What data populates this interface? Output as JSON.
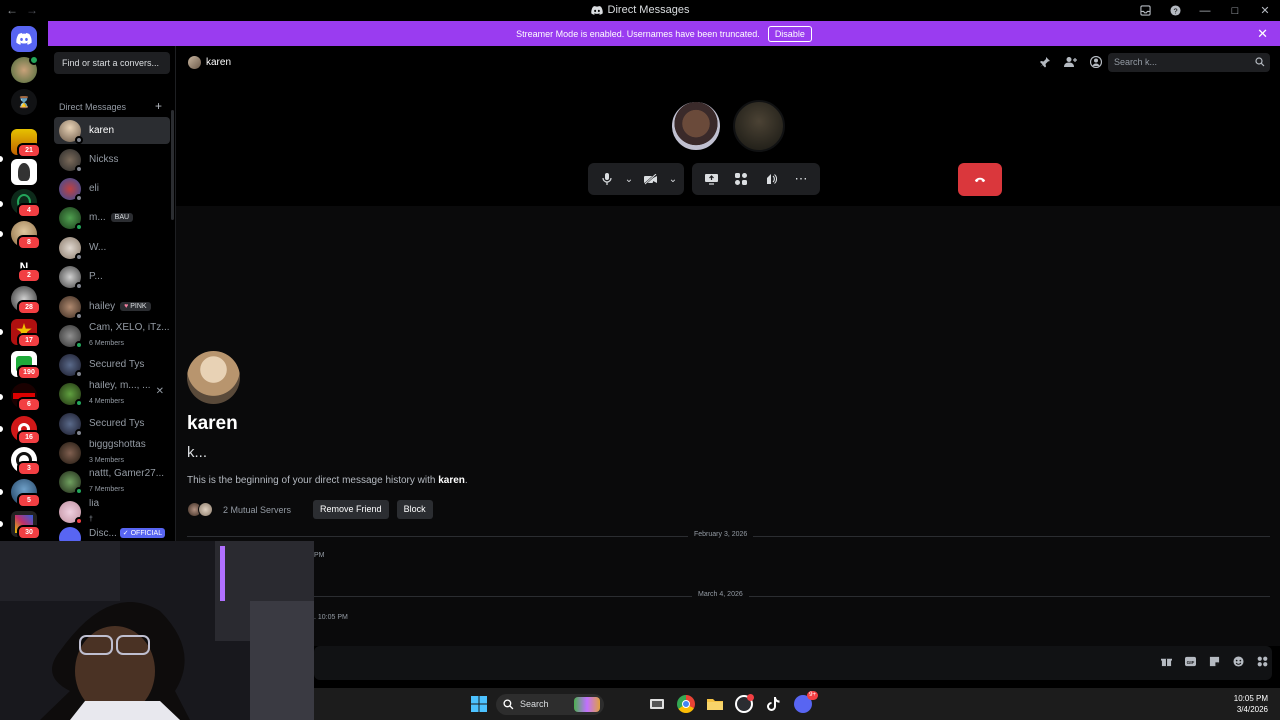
{
  "window": {
    "title": "Direct Messages"
  },
  "banner": {
    "text": "Streamer Mode is enabled. Usernames have been truncated.",
    "button": "Disable"
  },
  "servers": [
    {
      "badge": ""
    },
    {
      "badge": "21"
    },
    {
      "badge": ""
    },
    {
      "badge": "4"
    },
    {
      "badge": "8"
    },
    {
      "badge": "2"
    },
    {
      "badge": "28"
    },
    {
      "badge": "17"
    },
    {
      "badge": "190"
    },
    {
      "badge": "6"
    },
    {
      "badge": "16"
    },
    {
      "badge": "3"
    },
    {
      "badge": "5"
    },
    {
      "badge": "30"
    }
  ],
  "sidebar": {
    "find_placeholder": "Find or start a convers...",
    "section_title": "Direct Messages",
    "add_glyph": "+",
    "dms": [
      {
        "name": "karen",
        "sub": "",
        "tag": ""
      },
      {
        "name": "Nickss",
        "sub": "",
        "tag": ""
      },
      {
        "name": "eli",
        "sub": "",
        "tag": ""
      },
      {
        "name": "m...",
        "sub": "",
        "tag": "BAU"
      },
      {
        "name": "W...",
        "sub": "",
        "tag": ""
      },
      {
        "name": "P...",
        "sub": "",
        "tag": ""
      },
      {
        "name": "hailey",
        "sub": "",
        "tag": "PINK"
      },
      {
        "name": "Cam, XELO, iTz...",
        "sub": "6 Members",
        "tag": ""
      },
      {
        "name": "Secured Tys",
        "sub": "",
        "tag": ""
      },
      {
        "name": "hailey, m..., ...",
        "sub": "4 Members",
        "tag": ""
      },
      {
        "name": "Secured Tys",
        "sub": "",
        "tag": ""
      },
      {
        "name": "bigggshottas",
        "sub": "3 Members",
        "tag": ""
      },
      {
        "name": "nattt, Gamer27...",
        "sub": "7 Members",
        "tag": ""
      },
      {
        "name": "lia",
        "sub": "†",
        "tag": ""
      },
      {
        "name": "Disc...",
        "sub": "",
        "tag": "OFFICIAL"
      }
    ]
  },
  "header": {
    "name": "karen",
    "search_placeholder": "Search k..."
  },
  "profile": {
    "name": "karen",
    "sub": "k...",
    "beginning_prefix": "This is the beginning of your direct message history with ",
    "beginning_name": "karen",
    "beginning_suffix": ".",
    "mutual": "2 Mutual Servers",
    "remove": "Remove Friend",
    "block": "Block"
  },
  "messages": {
    "date1": "February 3, 2026",
    "time1": "PM",
    "date2": "March 4, 2026",
    "time2": ". 10:05 PM"
  },
  "taskbar": {
    "search": "Search",
    "time": "10:05 PM",
    "date": "3/4/2026",
    "discord_badge": "9+"
  },
  "colors": {
    "accent": "#9a3cf0",
    "hangup": "#da373c",
    "badge": "#f23f43",
    "online": "#23a55a"
  }
}
